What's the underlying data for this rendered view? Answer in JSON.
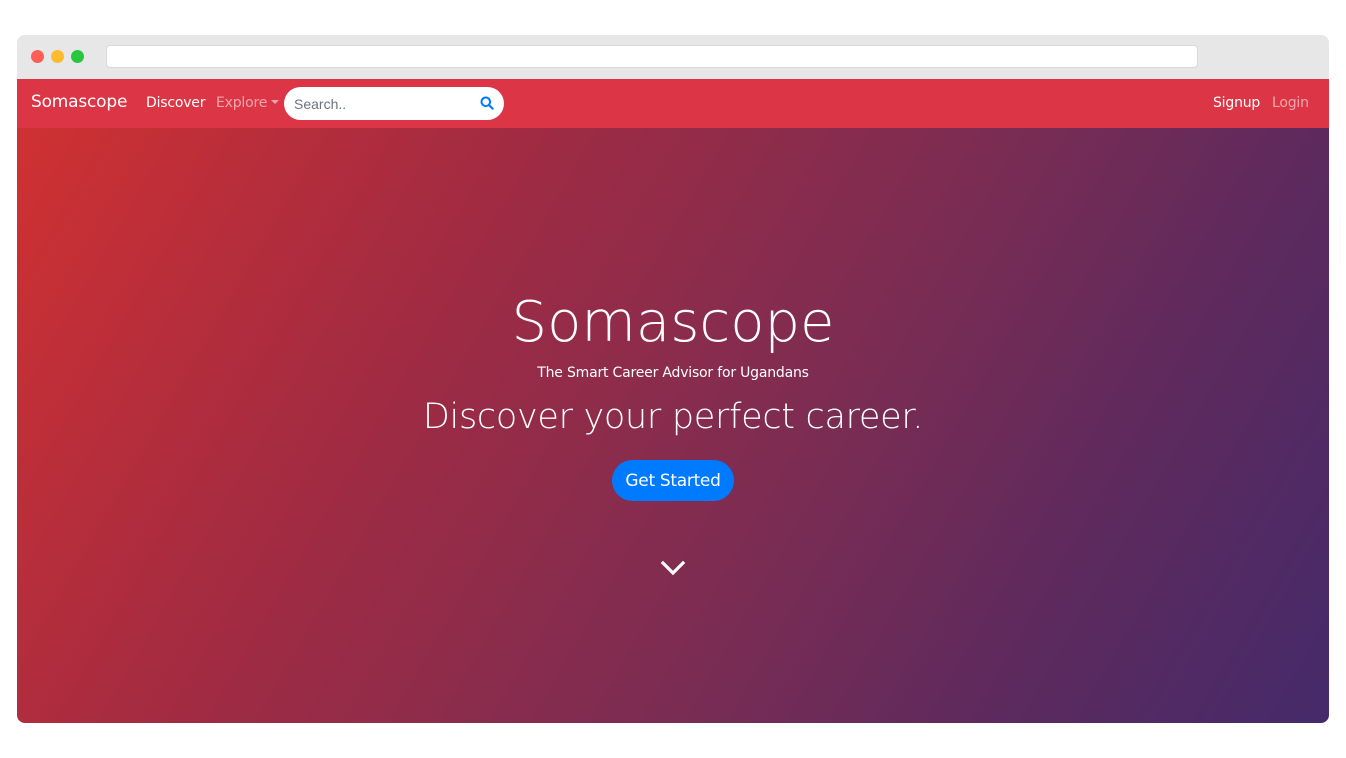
{
  "browser": {
    "url": ""
  },
  "navbar": {
    "brand": "Somascope",
    "links": {
      "discover": "Discover",
      "explore": "Explore",
      "signup": "Signup",
      "login": "Login"
    },
    "search": {
      "placeholder": "Search..",
      "value": "",
      "icon": "search-icon"
    },
    "color": "#dc3545"
  },
  "hero": {
    "title": "Somascope",
    "subtitle": "The Smart Career Advisor for Ugandans",
    "lead": "Discover your perfect career.",
    "cta_label": "Get Started",
    "cta_color": "#007bff",
    "scroll_icon": "chevron-down-icon",
    "gradient": {
      "from": "#cf3132",
      "to": "#452a6a"
    }
  }
}
